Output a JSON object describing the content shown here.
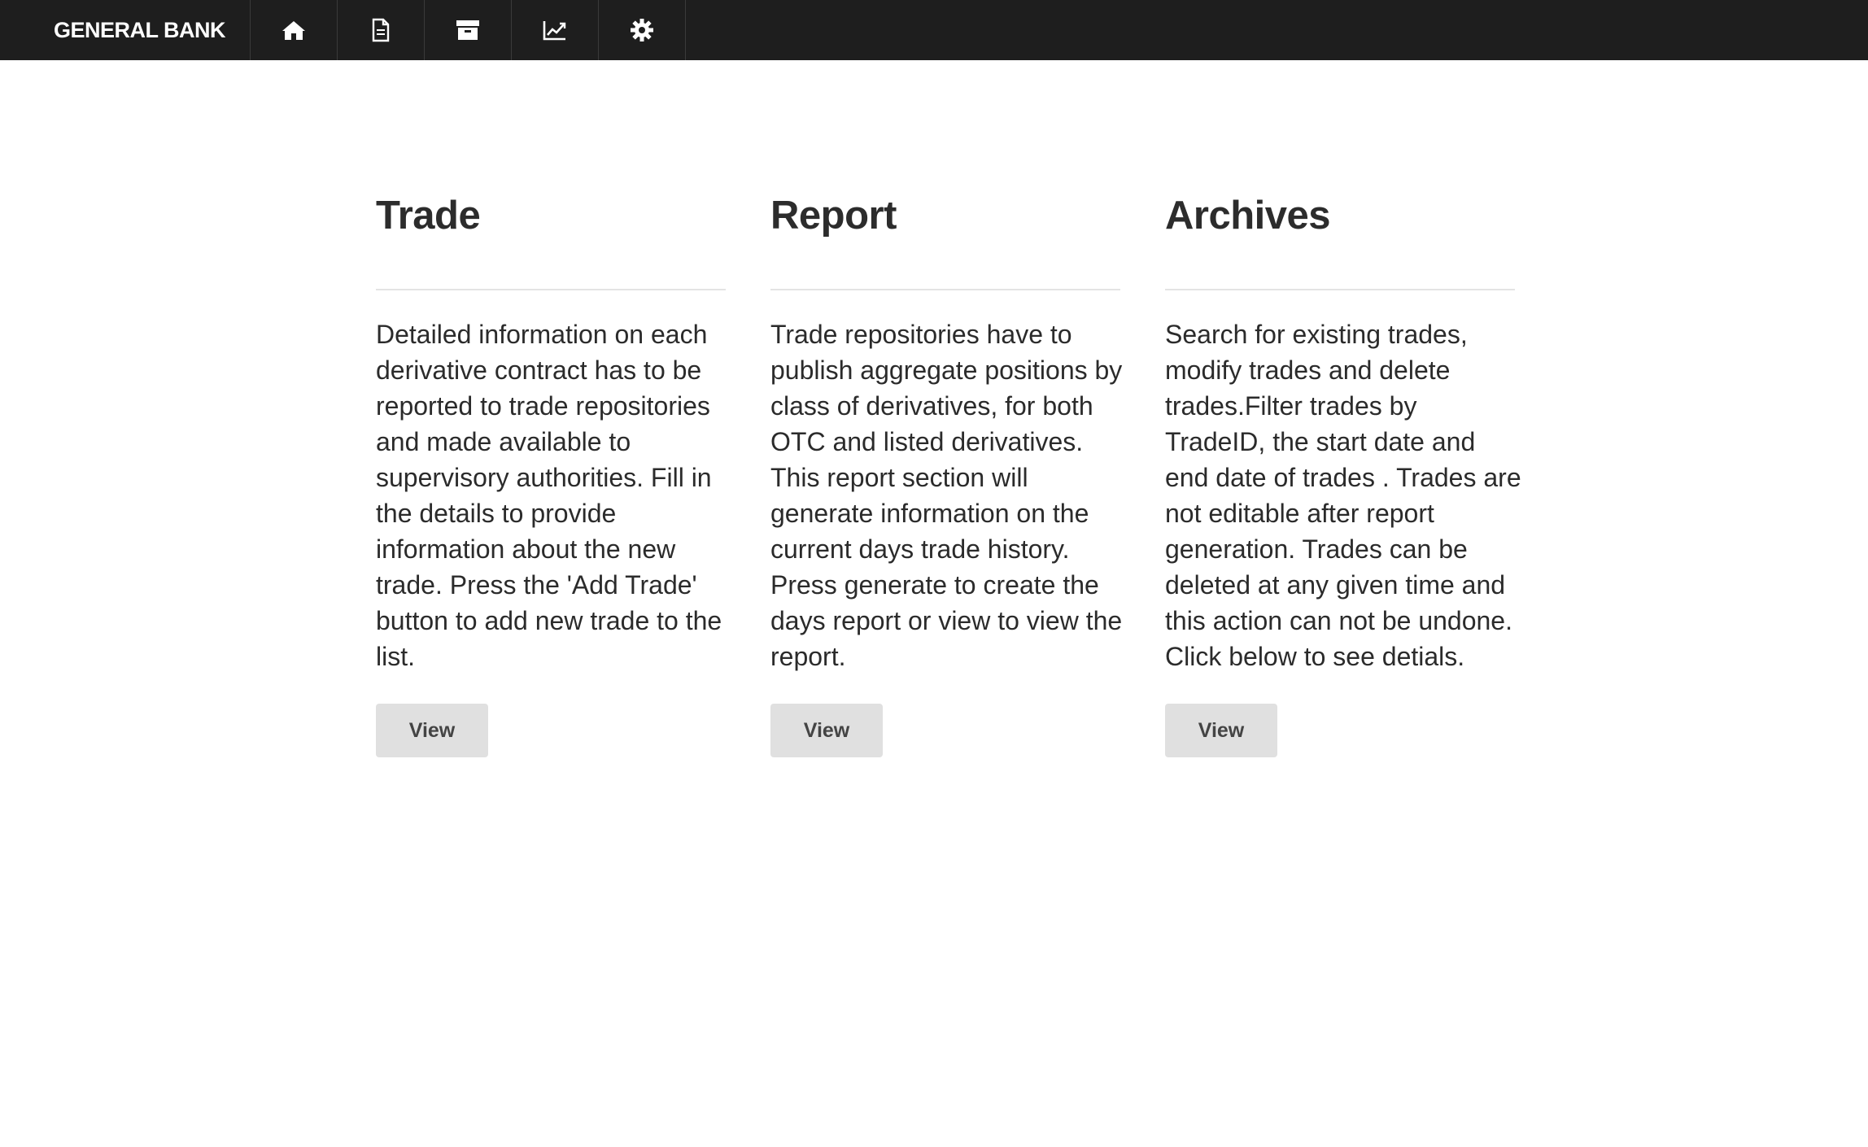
{
  "navbar": {
    "brand": "GENERAL BANK",
    "items": [
      {
        "icon": "home-icon"
      },
      {
        "icon": "document-icon"
      },
      {
        "icon": "archive-icon"
      },
      {
        "icon": "chart-icon"
      },
      {
        "icon": "gear-icon"
      }
    ],
    "colors": {
      "background": "#1e1e1e",
      "text": "#ffffff"
    }
  },
  "sections": [
    {
      "title": "Trade",
      "description": "Detailed information on each derivative contract has to be reported to trade repositories and made available to supervisory authorities. Fill in the details to provide information about the new trade. Press the 'Add Trade' button to add new trade to the list.",
      "button_label": "View"
    },
    {
      "title": "Report",
      "description": "Trade repositories have to publish aggregate positions by class of derivatives, for both OTC and listed derivatives. This report section will generate information on the current days trade history. Press generate to create the days report or view to view the report.",
      "button_label": "View"
    },
    {
      "title": "Archives",
      "description": "Search for existing trades, modify trades and delete trades.Filter trades by TradeID, the start date and end date of trades . Trades are not editable after report generation. Trades can be deleted at any given time and this action can not be undone. Click below to see detials.",
      "button_label": "View"
    }
  ]
}
